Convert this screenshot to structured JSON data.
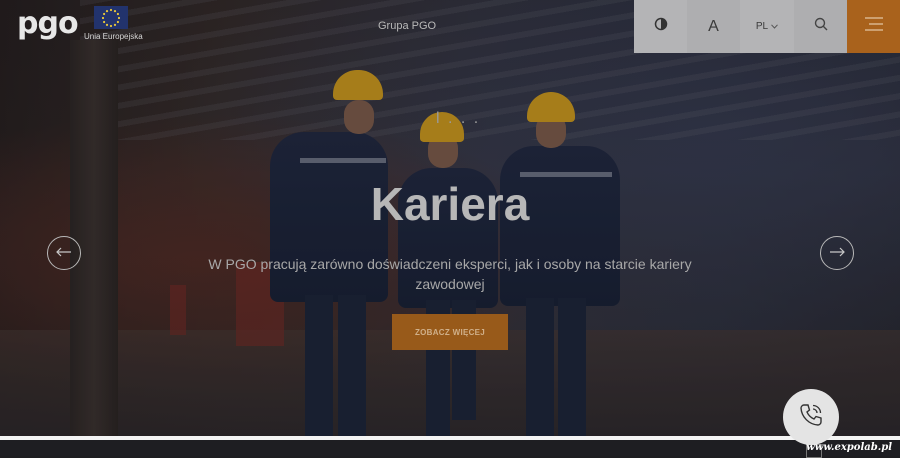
{
  "header": {
    "logo_text": "pgo",
    "eu_label": "Unia Europejska",
    "group_link": "Grupa PGO",
    "font_size_label": "A",
    "language": "PL",
    "icons": [
      "contrast-icon",
      "search-icon",
      "hamburger-menu-icon"
    ]
  },
  "hero": {
    "loader": "l . . .",
    "title": "Kariera",
    "subtitle": "W PGO pracują zarówno doświadczeni eksperci, jak i osoby na starcie kariery zawodowej",
    "cta_label": "ZOBACZ WIĘCEJ"
  },
  "footer": {
    "watermark": "www.expolab.pl"
  },
  "colors": {
    "accent": "#a9621c",
    "toolbar_gray": "#b4b4b6",
    "text_light": "#b7b7b7"
  }
}
